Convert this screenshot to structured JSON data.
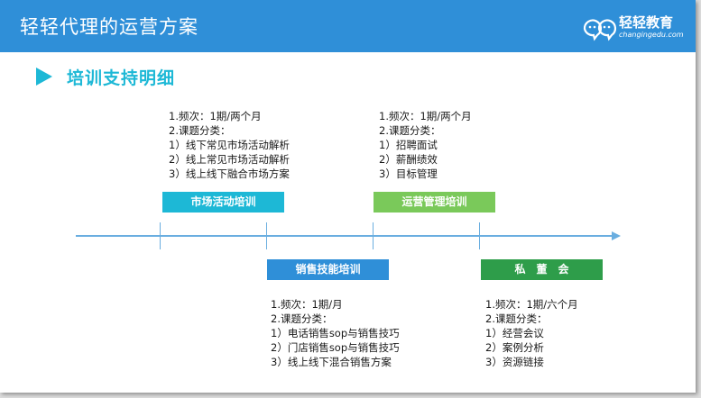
{
  "header": {
    "title": "轻轻代理的运营方案",
    "logo_name": "轻轻教育",
    "logo_domain": "changingedu.com"
  },
  "section": {
    "title": "培训支持明细"
  },
  "colors": {
    "header_bg": "#2f8fd8",
    "accent_cyan": "#1db8d6",
    "green": "#7ac95a",
    "blue": "#2f8fd8",
    "dark_green": "#2e9d4a",
    "timeline": "#6aaee0"
  },
  "trainings": {
    "market": {
      "label": "市场活动培训",
      "info": [
        "1.频次：1期/两个月",
        "2.课题分类：",
        "1）线下常见市场活动解析",
        "2）线上常见市场活动解析",
        "3）线上线下融合市场方案"
      ]
    },
    "sales": {
      "label": "销售技能培训",
      "info": [
        "1.频次：1期/月",
        "2.课题分类：",
        "1）电话销售sop与销售技巧",
        "2）门店销售sop与销售技巧",
        "3）线上线下混合销售方案"
      ]
    },
    "ops": {
      "label": "运营管理培训",
      "info": [
        "1.频次：1期/两个月",
        "2.课题分类：",
        "1）招聘面试",
        "2）薪酬绩效",
        "3）目标管理"
      ]
    },
    "board": {
      "label": "私　董　会",
      "info": [
        "1.频次：1期/六个月",
        "2.课题分类：",
        "1）经营会议",
        "2）案例分析",
        "3）资源链接"
      ]
    }
  }
}
